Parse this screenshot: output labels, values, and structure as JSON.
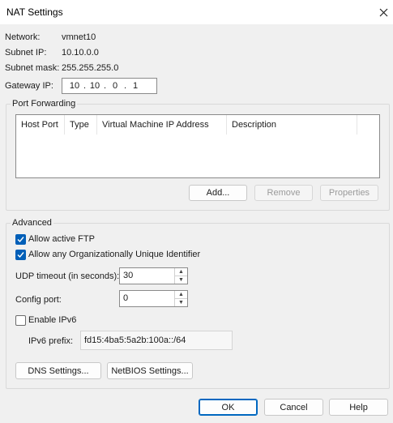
{
  "window": {
    "title": "NAT Settings",
    "close_icon": "close-icon"
  },
  "network": {
    "network_label": "Network:",
    "network_value": "vmnet10",
    "subnet_ip_label": "Subnet IP:",
    "subnet_ip_value": "10.10.0.0",
    "subnet_mask_label": "Subnet mask:",
    "subnet_mask_value": "255.255.255.0",
    "gateway_label": "Gateway IP:",
    "gateway_octets": [
      "10",
      "10",
      "0",
      "1"
    ]
  },
  "port_forwarding": {
    "legend": "Port Forwarding",
    "columns": [
      "Host Port",
      "Type",
      "Virtual Machine IP Address",
      "Description"
    ],
    "rows": [],
    "add_label": "Add...",
    "remove_label": "Remove",
    "properties_label": "Properties"
  },
  "advanced": {
    "legend": "Advanced",
    "allow_ftp_label": "Allow active FTP",
    "allow_ftp_checked": true,
    "allow_oui_label": "Allow any Organizationally Unique Identifier",
    "allow_oui_checked": true,
    "udp_timeout_label": "UDP timeout (in seconds):",
    "udp_timeout_value": "30",
    "config_port_label": "Config port:",
    "config_port_value": "0",
    "enable_ipv6_label": "Enable IPv6",
    "enable_ipv6_checked": false,
    "ipv6_prefix_label": "IPv6 prefix:",
    "ipv6_prefix_value": "fd15:4ba5:5a2b:100a::/64",
    "dns_label": "DNS Settings...",
    "netbios_label": "NetBIOS Settings..."
  },
  "footer": {
    "ok_label": "OK",
    "cancel_label": "Cancel",
    "help_label": "Help"
  },
  "colors": {
    "accent": "#005fb8",
    "background": "#f0f0f0"
  }
}
